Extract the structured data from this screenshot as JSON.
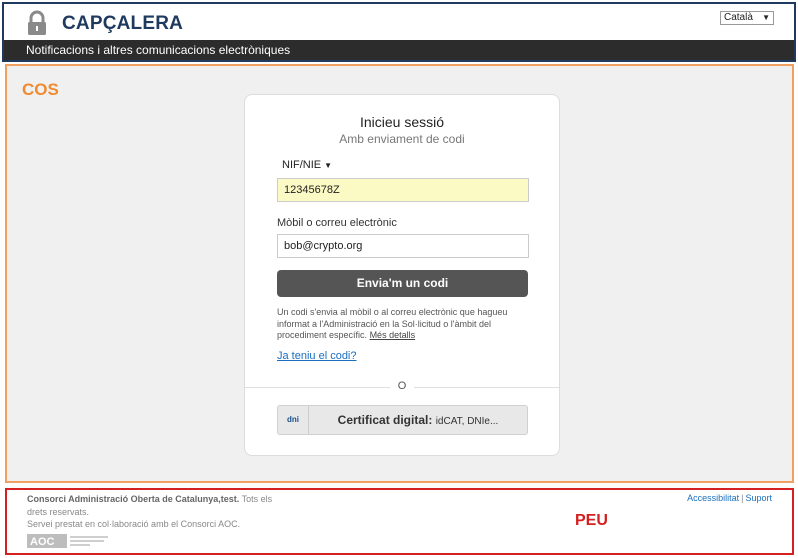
{
  "header": {
    "region_label": "CAPÇALERA",
    "language": "Català",
    "subtitle": "Notificacions i altres comunicacions electròniques"
  },
  "body": {
    "region_label": "COS",
    "login": {
      "title": "Inicieu sessió",
      "subtitle": "Amb enviament de codi",
      "id_type": "NIF/NIE",
      "id_value": "12345678Z",
      "contact_label": "Mòbil o correu electrònic",
      "contact_value": "bob@crypto.org",
      "send_button": "Envia'm un codi",
      "info_text": "Un codi s'envia al mòbil o al correu electrònic que hagueu informat a l'Administració en la Sol·licitud o l'àmbit del procediment específic.",
      "more_details": "Més detalls",
      "have_code_link": "Ja teniu el codi?",
      "or_label": "O",
      "cert_icon_text": "dni",
      "cert_button": "Certificat digital:",
      "cert_button_small": "idCAT, DNIe..."
    }
  },
  "footer": {
    "region_label": "PEU",
    "org_name": "Consorci Administració Oberta de Catalunya,test.",
    "rights": "Tots els drets reservats.",
    "service": "Servei prestat en col·laboració amb el Consorci AOC.",
    "link_accessibility": "Accessibilitat",
    "link_separator": "|",
    "link_support": "Suport",
    "logo_text": "AOC"
  },
  "colors": {
    "header_border": "#1f3a5f",
    "body_border": "#f0a060",
    "footer_border": "#d42020",
    "link": "#1a6fbf",
    "id_field_bg": "#fbf9c4"
  }
}
